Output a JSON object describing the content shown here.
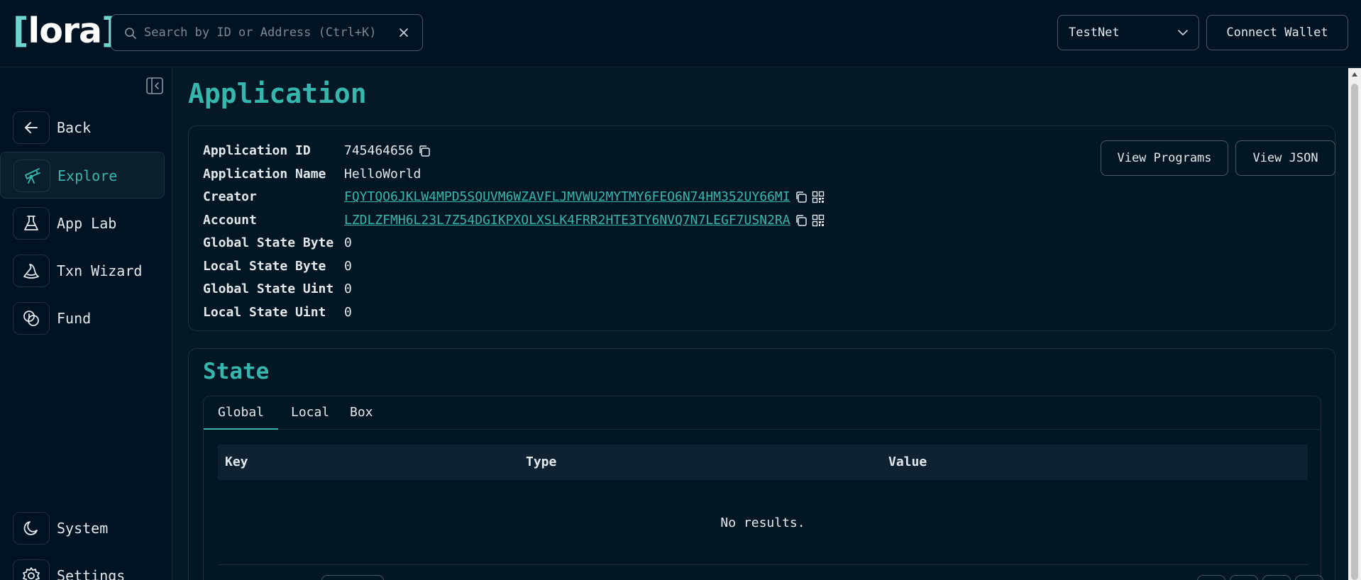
{
  "header": {
    "logo": {
      "bracket_open": "[",
      "text": "lora",
      "bracket_close": "]"
    },
    "search": {
      "placeholder": "Search by ID or Address (Ctrl+K)",
      "value": ""
    },
    "network": {
      "selected": "TestNet"
    },
    "connect_label": "Connect Wallet"
  },
  "sidebar": {
    "items": [
      {
        "label": "Back",
        "icon": "arrow-left-icon"
      },
      {
        "label": "Explore",
        "icon": "telescope-icon",
        "active": true
      },
      {
        "label": "App Lab",
        "icon": "flask-icon"
      },
      {
        "label": "Txn Wizard",
        "icon": "wizard-hat-icon"
      },
      {
        "label": "Fund",
        "icon": "coins-icon"
      }
    ],
    "bottom": [
      {
        "label": "System",
        "icon": "moon-icon"
      },
      {
        "label": "Settings",
        "icon": "gear-icon"
      }
    ]
  },
  "main": {
    "title": "Application",
    "info": {
      "rows": [
        {
          "key": "Application ID",
          "value": "745464656"
        },
        {
          "key": "Application Name",
          "value": "HelloWorld"
        },
        {
          "key": "Creator",
          "value": "FQYTQO6JKLW4MPD5SQUVM6WZAVFLJMVWU2MYTMY6FEO6N74HM352UY66MI"
        },
        {
          "key": "Account",
          "value": "LZDLZFMH6L23L7Z54DGIKPXOLXSLK4FRR2HTE3TY6NVQ7N7LEGF7USN2RA"
        },
        {
          "key": "Global State Byte",
          "value": "0"
        },
        {
          "key": "Local State Byte",
          "value": "0"
        },
        {
          "key": "Global State Uint",
          "value": "0"
        },
        {
          "key": "Local State Uint",
          "value": "0"
        }
      ],
      "buttons": {
        "view_programs": "View Programs",
        "view_json": "View JSON"
      }
    },
    "state": {
      "title": "State",
      "tabs": [
        {
          "label": "Global",
          "active": true
        },
        {
          "label": "Local"
        },
        {
          "label": "Box"
        }
      ],
      "columns": [
        "Key",
        "Type",
        "Value"
      ],
      "empty_text": "No results."
    }
  },
  "colors": {
    "accent": "#35b7ad",
    "background": "#001322",
    "panel": "#031624",
    "border": "#1c3040"
  }
}
